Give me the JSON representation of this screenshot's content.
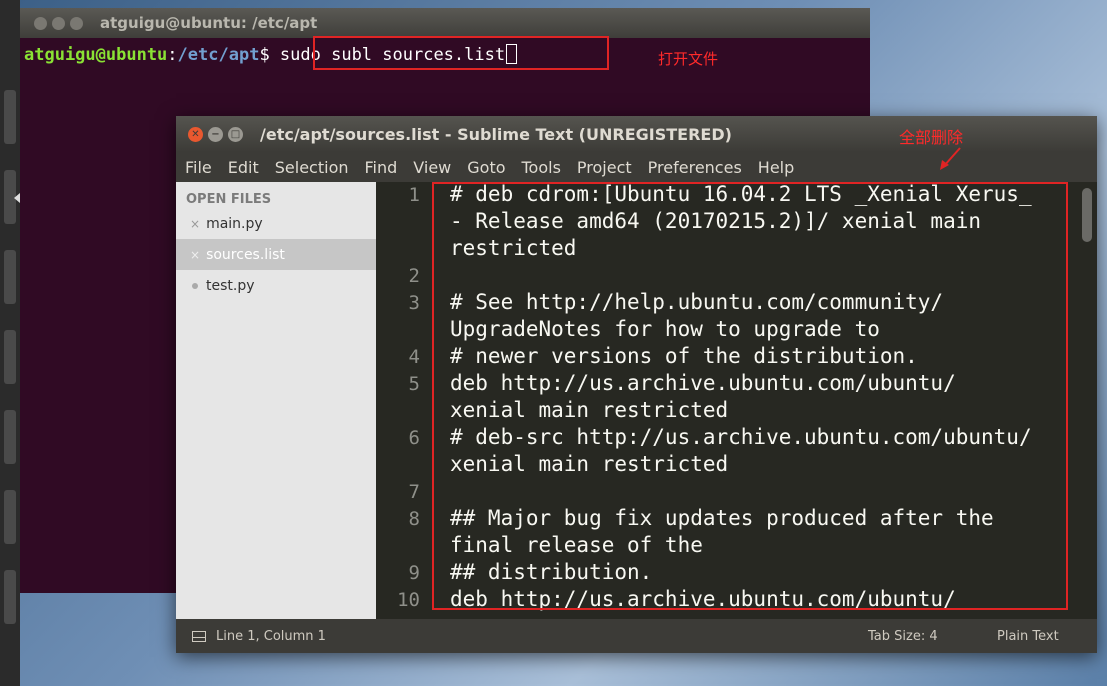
{
  "terminal": {
    "title": "atguigu@ubuntu: /etc/apt",
    "prompt_user": "atguigu@ubuntu",
    "prompt_sep": ":",
    "prompt_path": "/etc/apt",
    "prompt_dollar": "$ ",
    "command": "sudo subl sources.list",
    "annotation": "打开文件"
  },
  "sublime": {
    "title": "/etc/apt/sources.list - Sublime Text (UNREGISTERED)",
    "annotation": "全部删除",
    "menu": [
      "File",
      "Edit",
      "Selection",
      "Find",
      "View",
      "Goto",
      "Tools",
      "Project",
      "Preferences",
      "Help"
    ],
    "sidebar": {
      "header": "OPEN FILES",
      "files": [
        {
          "name": "main.py",
          "marker": "×"
        },
        {
          "name": "sources.list",
          "marker": "×"
        },
        {
          "name": "test.py",
          "marker": "●"
        }
      ]
    },
    "line_numbers": [
      "1",
      "2",
      "3",
      "4",
      "5",
      "6",
      "7",
      "8",
      "9",
      "10"
    ],
    "code_lines": [
      "# deb cdrom:[Ubuntu 16.04.2 LTS _Xenial Xerus_",
      "- Release amd64 (20170215.2)]/ xenial main",
      "restricted",
      "",
      "# See http://help.ubuntu.com/community/",
      "UpgradeNotes for how to upgrade to",
      "# newer versions of the distribution.",
      "deb http://us.archive.ubuntu.com/ubuntu/",
      "xenial main restricted",
      "# deb-src http://us.archive.ubuntu.com/ubuntu/",
      "xenial main restricted",
      "",
      "## Major bug fix updates produced after the",
      "final release of the",
      "## distribution.",
      "deb http://us.archive.ubuntu.com/ubuntu/"
    ],
    "status": {
      "position": "Line 1, Column 1",
      "tab_size": "Tab Size: 4",
      "syntax": "Plain Text"
    }
  },
  "colors": {
    "terminal_bg": "#300a24",
    "editor_bg": "#272822",
    "annotation_red": "#e02424"
  }
}
